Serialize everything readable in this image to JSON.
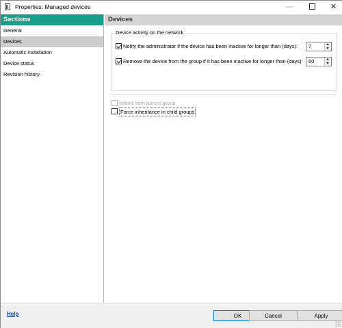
{
  "window": {
    "title": "Properties: Managed devices",
    "controls": {
      "minimize": "—",
      "close": "✕"
    }
  },
  "sections": {
    "header": "Sections",
    "items": [
      {
        "label": "General",
        "selected": false
      },
      {
        "label": "Devices",
        "selected": true
      },
      {
        "label": "Automatic installation",
        "selected": false
      },
      {
        "label": "Device status",
        "selected": false
      },
      {
        "label": "Revision history",
        "selected": false
      }
    ]
  },
  "content": {
    "header": "Devices",
    "group_title": "Device activity on the network",
    "notify": {
      "label": "Notify the administrator if the device has been inactive for longer than (days):",
      "checked": true,
      "value": "7"
    },
    "remove": {
      "label": "Remove the device from the group if it has been inactive for longer than (days):",
      "checked": true,
      "value": "60"
    },
    "inherit": {
      "label": "Inherit from parent group",
      "checked": false,
      "disabled": true
    },
    "force": {
      "label": "Force inheritance in child groups",
      "checked": false
    }
  },
  "footer": {
    "help": "Help",
    "ok": "OK",
    "cancel": "Cancel",
    "apply": "Apply"
  },
  "colors": {
    "sections_header": "#1a9e8a",
    "selected_item": "#cccccc",
    "content_header": "#d4d4d4",
    "link": "#0645ad"
  },
  "icons": [
    "app-icon",
    "minimize-icon",
    "maximize-icon",
    "close-icon",
    "spin-up-icon",
    "spin-down-icon",
    "resize-grip-icon"
  ]
}
